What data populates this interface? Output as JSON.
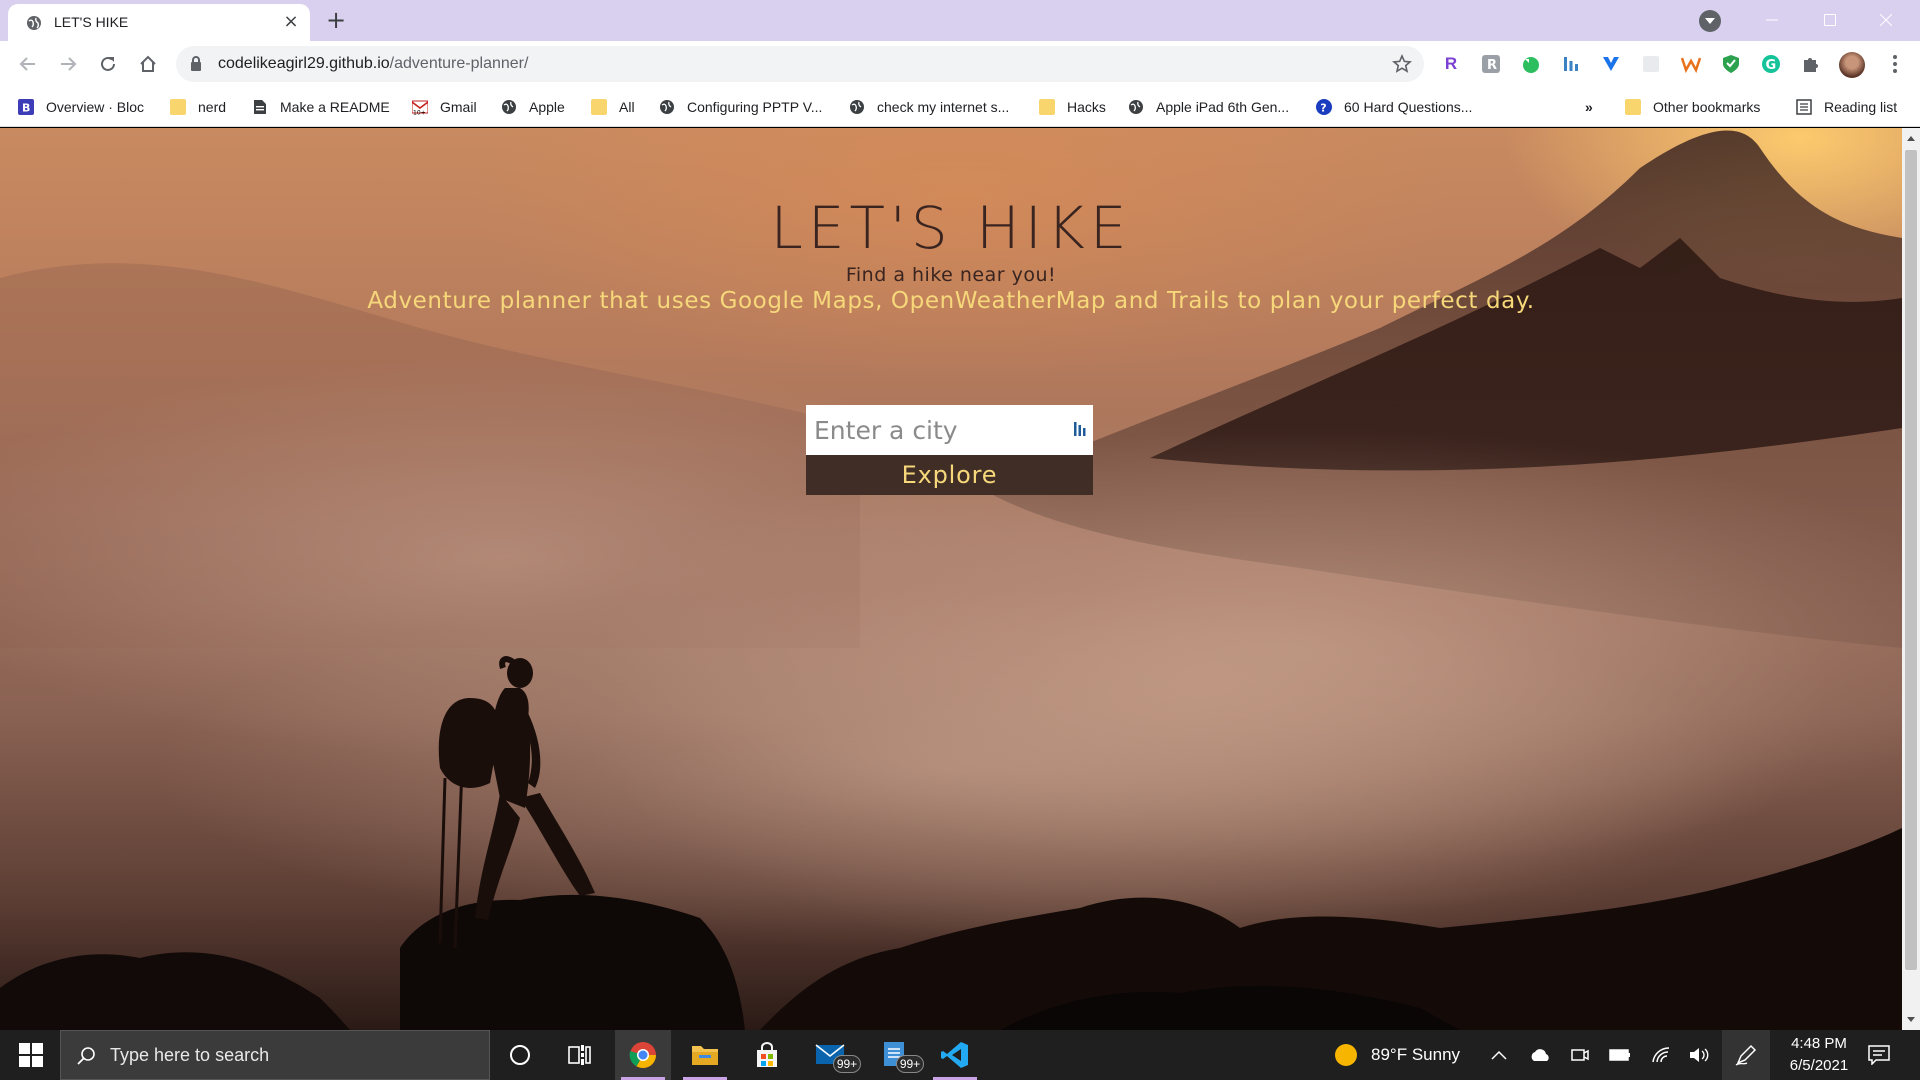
{
  "browser": {
    "tab_title": "LET'S HIKE",
    "url_host": "codelikeagirl29.github.io",
    "url_path": "/adventure-planner/",
    "bookmarks": [
      {
        "label": "Overview · Bloc",
        "icon": "bloc-icon"
      },
      {
        "label": "nerd",
        "icon": "folder-icon"
      },
      {
        "label": "Make a README",
        "icon": "document-icon"
      },
      {
        "label": "Gmail",
        "icon": "gmail-icon"
      },
      {
        "label": "Apple",
        "icon": "globe-icon"
      },
      {
        "label": "All",
        "icon": "folder-icon"
      },
      {
        "label": "Configuring PPTP V...",
        "icon": "globe-icon"
      },
      {
        "label": "check my internet s...",
        "icon": "globe-icon"
      },
      {
        "label": "Hacks",
        "icon": "folder-icon"
      },
      {
        "label": "Apple iPad 6th Gen...",
        "icon": "globe-icon"
      },
      {
        "label": "60 Hard Questions...",
        "icon": "question-icon"
      }
    ],
    "bookmarks_overflow": "»",
    "other_bookmarks": "Other bookmarks",
    "reading_list": "Reading list"
  },
  "page": {
    "title": "LET'S HIKE",
    "subtitle": "Find a hike near you!",
    "description": "Adventure planner that uses Google Maps, OpenWeatherMap and Trails to plan your perfect day.",
    "search_placeholder": "Enter a city",
    "search_value": "",
    "explore_label": "Explore"
  },
  "taskbar": {
    "search_placeholder": "Type here to search",
    "mail_badge": "99+",
    "notepad_badge": "99+",
    "weather": "89°F  Sunny",
    "time": "4:48 PM",
    "date": "6/5/2021"
  },
  "colors": {
    "tabstrip": "#d9cfee",
    "accent_text": "#f6d77a",
    "button_bg": "#3f2d26",
    "title_text": "#3a2420"
  }
}
